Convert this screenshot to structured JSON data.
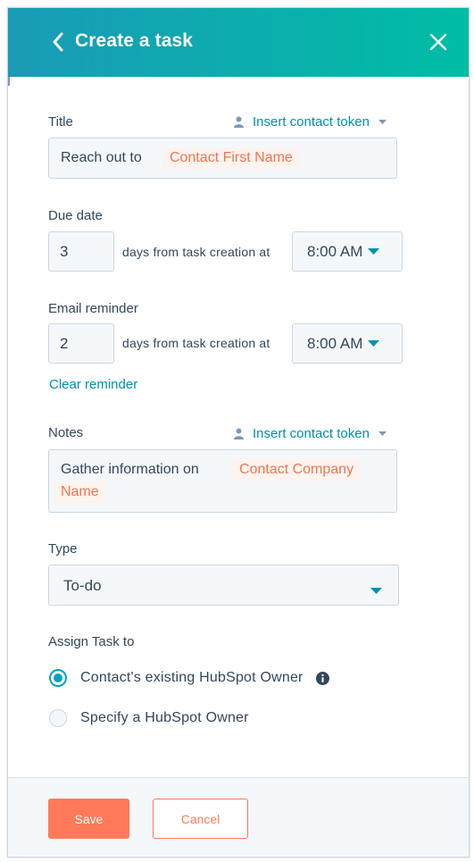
{
  "header": {
    "title": "Create a task",
    "back_icon": "chevron-left-icon",
    "close_icon": "close-icon"
  },
  "colors": {
    "header_start": "#1a9bb7",
    "header_end": "#00bda5",
    "link": "#0091ae",
    "token_text": "#f2754f",
    "primary_button": "#ff7a59"
  },
  "title_field": {
    "label": "Title",
    "insert_token_label": "Insert contact token",
    "text": "Reach out to",
    "token": "Contact First Name"
  },
  "due_date": {
    "label": "Due date",
    "days": "3",
    "days_text": "days from task creation at",
    "time": "8:00 AM"
  },
  "email_reminder": {
    "label": "Email reminder",
    "days": "2",
    "days_text": "days from task creation at",
    "time": "8:00 AM",
    "clear_label": "Clear reminder"
  },
  "notes": {
    "label": "Notes",
    "insert_token_label": "Insert contact token",
    "text": "Gather information on",
    "token_line1": "Contact Company",
    "token_line2": "Name"
  },
  "type": {
    "label": "Type",
    "selected": "To-do"
  },
  "assign": {
    "label": "Assign Task to",
    "options": [
      {
        "label": "Contact's existing HubSpot Owner",
        "selected": true
      },
      {
        "label": "Specify a HubSpot Owner",
        "selected": false
      }
    ]
  },
  "footer": {
    "save_label": "Save",
    "cancel_label": "Cancel"
  }
}
